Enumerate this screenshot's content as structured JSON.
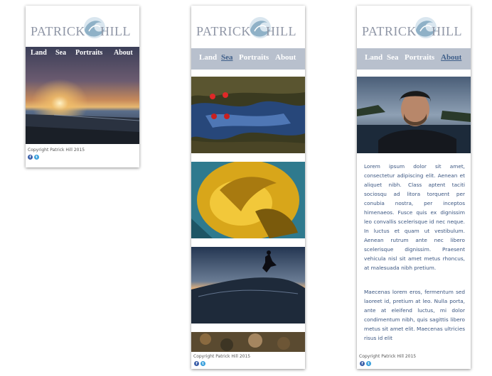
{
  "brand": {
    "left": "PATRICK",
    "right": "HILL"
  },
  "nav": {
    "land": "Land",
    "sea": "Sea",
    "portraits": "Portraits",
    "about": "About"
  },
  "footer": {
    "copyright": "Copyright Patrick Hill 2015",
    "facebook_glyph": "f",
    "twitter_glyph": "t"
  },
  "about": {
    "paragraph1": "Lorem ipsum dolor sit amet, consectetur adipiscing elit. Aenean et aliquet nibh. Class aptent taciti sociosqu ad litora torquent per conubia nostra, per inceptos himenaeos. Fusce quis ex dignissim leo convallis scelerisque id nec neque. In luctus et quam ut vestibulum. Aenean rutrum ante nec libero scelerisque dignissim. Praesent vehicula nisl sit amet metus rhoncus, at malesuada nibh pretium.",
    "paragraph2": "Maecenas lorem eros, fermentum sed laoreet id, pretium at leo. Nulla porta, ante at eleifend luctus, mi dolor condimentum nibh, quis sagittis libero metus sit amet elit. Maecenas ultricies risus id elit"
  },
  "colors": {
    "nav_bg": "#b8c0cd",
    "active_link": "#3f5f8a",
    "logo": "#8f96a6",
    "body_text": "#3a5580"
  },
  "icons": [
    "wave-logo-icon",
    "facebook-icon",
    "twitter-icon"
  ]
}
